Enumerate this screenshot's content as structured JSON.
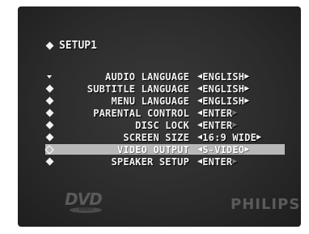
{
  "menu": {
    "title": "SETUP1",
    "items": [
      {
        "label": "AUDIO LANGUAGE",
        "value": "ENGLISH",
        "marker": "down-arrow",
        "selected": false
      },
      {
        "label": "SUBTITLE LANGUAGE",
        "value": "ENGLISH",
        "marker": "diamond",
        "selected": false
      },
      {
        "label": "MENU LANGUAGE",
        "value": "ENGLISH",
        "marker": "diamond",
        "selected": false
      },
      {
        "label": "PARENTAL CONTROL",
        "value": "ENTER",
        "marker": "diamond",
        "selected": false
      },
      {
        "label": "DISC LOCK",
        "value": "ENTER",
        "marker": "diamond",
        "selected": false
      },
      {
        "label": "SCREEN SIZE",
        "value": "16:9 WIDE",
        "marker": "diamond",
        "selected": false
      },
      {
        "label": "VIDEO OUTPUT",
        "value": "S-VIDEO",
        "marker": "outline-diamond",
        "selected": true
      },
      {
        "label": "SPEAKER SETUP",
        "value": "ENTER",
        "marker": "diamond",
        "selected": false
      }
    ]
  },
  "logos": {
    "dvd": "DVD",
    "dvd_sub": "VIDEO",
    "brand": "PHILIPS"
  },
  "colors": {
    "background": "#2c2c2c",
    "text": "#f2f2f2",
    "highlight": "#b8b8b8"
  }
}
